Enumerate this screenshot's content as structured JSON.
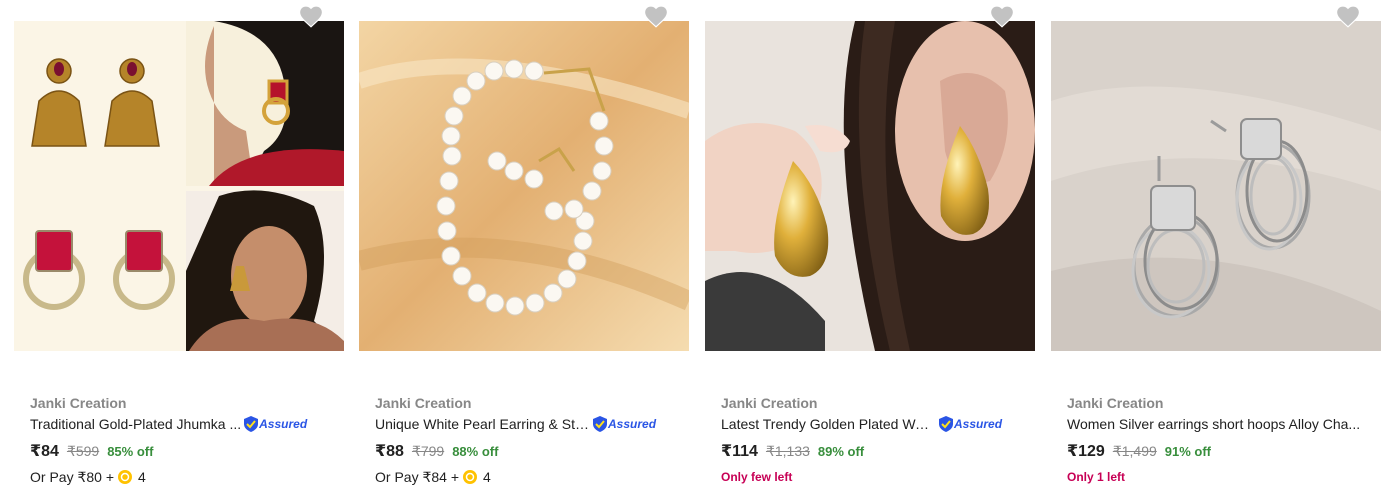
{
  "products": [
    {
      "brand": "Janki Creation",
      "title": "Traditional Gold-Plated Jhumka ...",
      "assured": "Assured",
      "price": "₹84",
      "mrp": "₹599",
      "discount": "85% off",
      "pay_text": "Or Pay ₹80 +",
      "coins": "4",
      "stock": ""
    },
    {
      "brand": "Janki Creation",
      "title": "Unique White Pearl Earring & Stu...",
      "assured": "Assured",
      "price": "₹88",
      "mrp": "₹799",
      "discount": "88% off",
      "pay_text": "Or Pay ₹84 +",
      "coins": "4",
      "stock": ""
    },
    {
      "brand": "Janki Creation",
      "title": "Latest Trendy Golden Plated Wat...",
      "assured": "Assured",
      "price": "₹114",
      "mrp": "₹1,133",
      "discount": "89% off",
      "pay_text": "",
      "coins": "",
      "stock": "Only few left"
    },
    {
      "brand": "Janki Creation",
      "title": "Women Silver earrings short hoops Alloy Cha...",
      "assured": "",
      "price": "₹129",
      "mrp": "₹1,499",
      "discount": "91% off",
      "pay_text": "",
      "coins": "",
      "stock": "Only 1 left"
    }
  ],
  "colors": {
    "discount": "#388e3c",
    "stock_warning": "#c70055",
    "assured_blue": "#2a55e5",
    "brand_grey": "#878787"
  }
}
